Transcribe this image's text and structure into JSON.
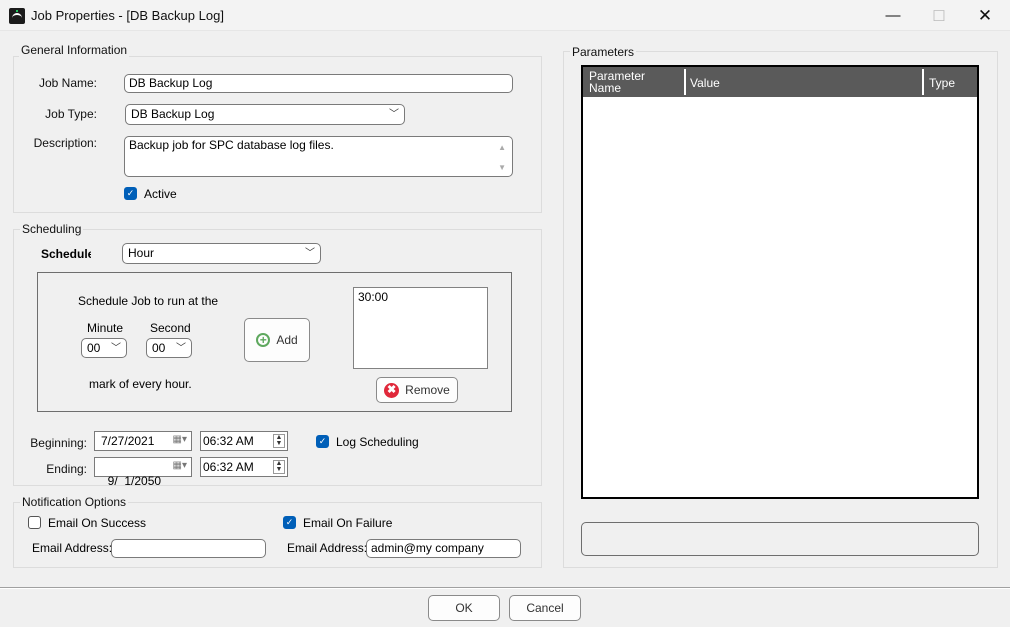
{
  "window": {
    "title": "Job Properties - [DB Backup Log]",
    "controls": {
      "minimize": "—",
      "maximize": "☐",
      "close": "✕"
    }
  },
  "general": {
    "legend": "General Information",
    "job_name_label": "Job Name:",
    "job_name_value": "DB Backup Log",
    "job_type_label": "Job Type:",
    "job_type_value": "DB Backup Log",
    "description_label": "Description:",
    "description_value": "Backup job for SPC database log files.",
    "active_label": "Active",
    "active_checked": true
  },
  "scheduling": {
    "legend": "Scheduling",
    "schedule_label": "Schedule",
    "schedule_value": "Hour",
    "run_at_text": "Schedule Job to run at the",
    "minute_label": "Minute",
    "minute_value": "00",
    "second_label": "Second",
    "second_value": "00",
    "mark_text": "mark of every hour.",
    "add_label": "Add",
    "times": [
      "30:00"
    ],
    "remove_label": "Remove",
    "beginning_label": "Beginning:",
    "beginning_date": "7/27/2021",
    "beginning_time": "06:32 AM",
    "ending_label": "Ending:",
    "ending_date": "9/  1/2050",
    "ending_time": "06:32 AM",
    "log_scheduling_label": "Log Scheduling",
    "log_scheduling_checked": true
  },
  "notification": {
    "legend": "Notification Options",
    "success_label": "Email On Success",
    "success_checked": false,
    "success_email_label": "Email Address:",
    "success_email_value": "",
    "failure_label": "Email On Failure",
    "failure_checked": true,
    "failure_email_label": "Email Address:",
    "failure_email_value": "admin@my company"
  },
  "parameters": {
    "legend": "Parameters",
    "columns": [
      "Parameter Name",
      "Value",
      "Type"
    ],
    "rows": [],
    "header_color": "#5a5a5a"
  },
  "footer": {
    "ok_label": "OK",
    "cancel_label": "Cancel"
  }
}
